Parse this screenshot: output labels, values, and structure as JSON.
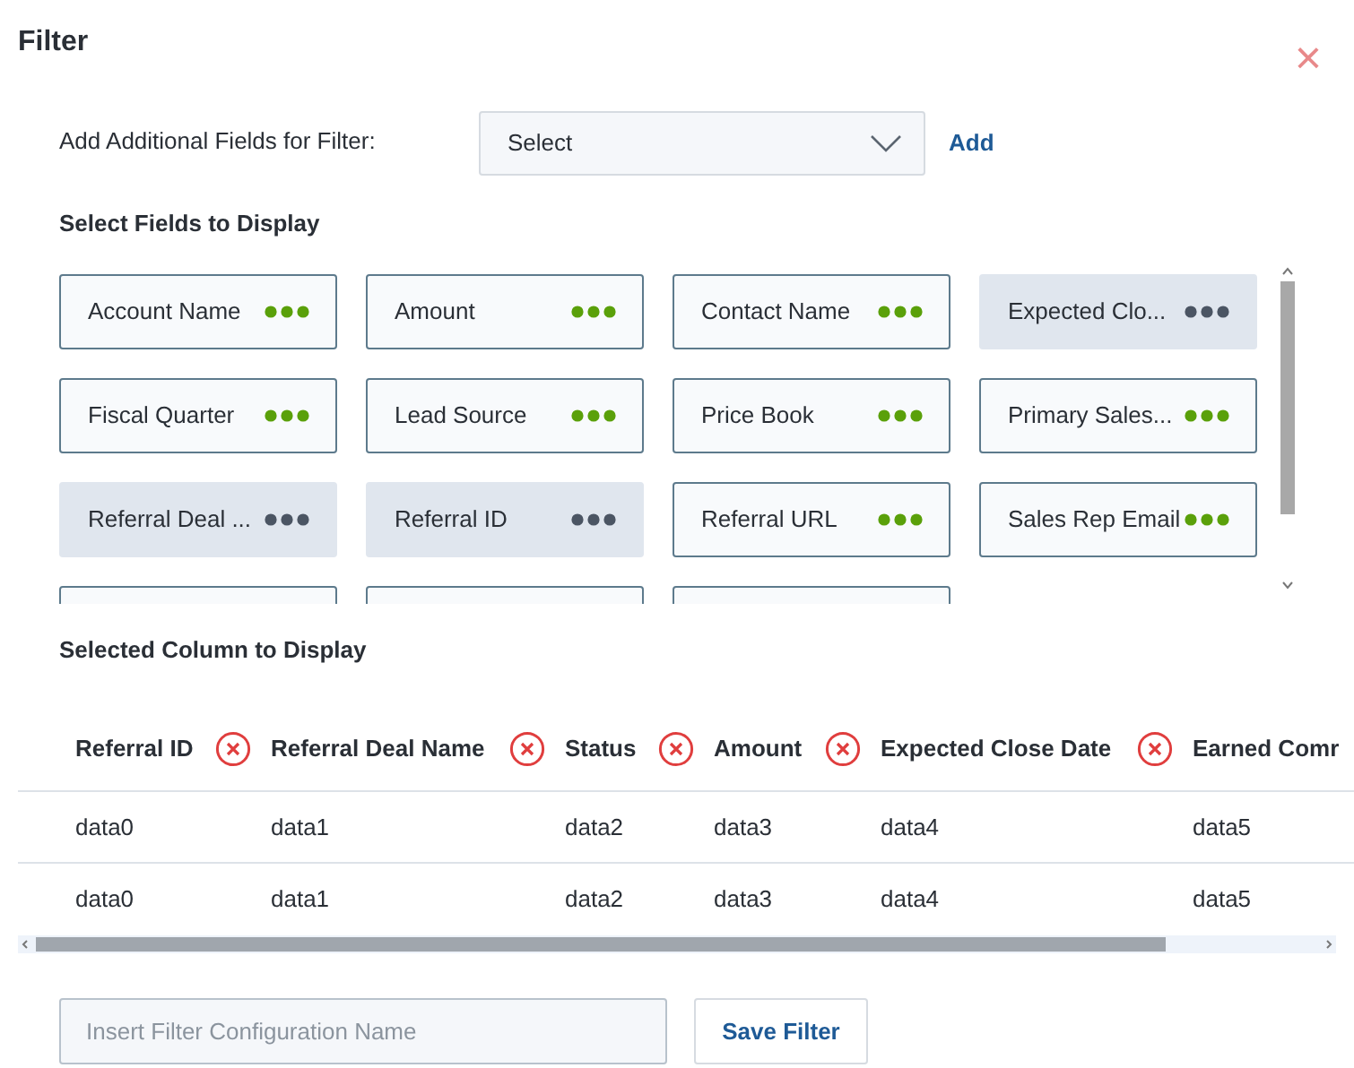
{
  "dialog": {
    "title": "Filter",
    "close": "×"
  },
  "add_field": {
    "label": "Add Additional Fields for Filter:",
    "select": {
      "value": "Select"
    },
    "add_link": "Add"
  },
  "fields_heading": "Select Fields to Display",
  "fields": [
    {
      "kind": "field",
      "label": "Account Name",
      "selected": false
    },
    {
      "kind": "field",
      "label": "Amount",
      "selected": false
    },
    {
      "kind": "field",
      "label": "Contact Name",
      "selected": false
    },
    {
      "kind": "field",
      "label": "Expected Clo...",
      "selected": true
    },
    {
      "kind": "field",
      "label": "Fiscal Quarter",
      "selected": false
    },
    {
      "kind": "field",
      "label": "Lead Source",
      "selected": false
    },
    {
      "kind": "field",
      "label": "Price Book",
      "selected": false
    },
    {
      "kind": "field",
      "label": "Primary Sales...",
      "selected": false
    },
    {
      "kind": "field",
      "label": "Referral Deal ...",
      "selected": true
    },
    {
      "kind": "field",
      "label": "Referral ID",
      "selected": true
    },
    {
      "kind": "field",
      "label": "Referral URL",
      "selected": false
    },
    {
      "kind": "field",
      "label": "Sales Rep Email",
      "selected": false
    },
    {
      "kind": "cut"
    },
    {
      "kind": "cut"
    },
    {
      "kind": "cut"
    }
  ],
  "columns_heading": "Selected Column to Display",
  "table": {
    "columns": [
      "Referral ID",
      "Referral Deal Name",
      "Status",
      "Amount",
      "Expected Close Date",
      "Earned Comr"
    ],
    "rows": [
      [
        "data0",
        "data1",
        "data2",
        "data3",
        "data4",
        "data5"
      ],
      [
        "data0",
        "data1",
        "data2",
        "data3",
        "data4",
        "data5"
      ]
    ]
  },
  "save": {
    "placeholder": "Insert Filter Configuration Name",
    "button": "Save Filter"
  }
}
